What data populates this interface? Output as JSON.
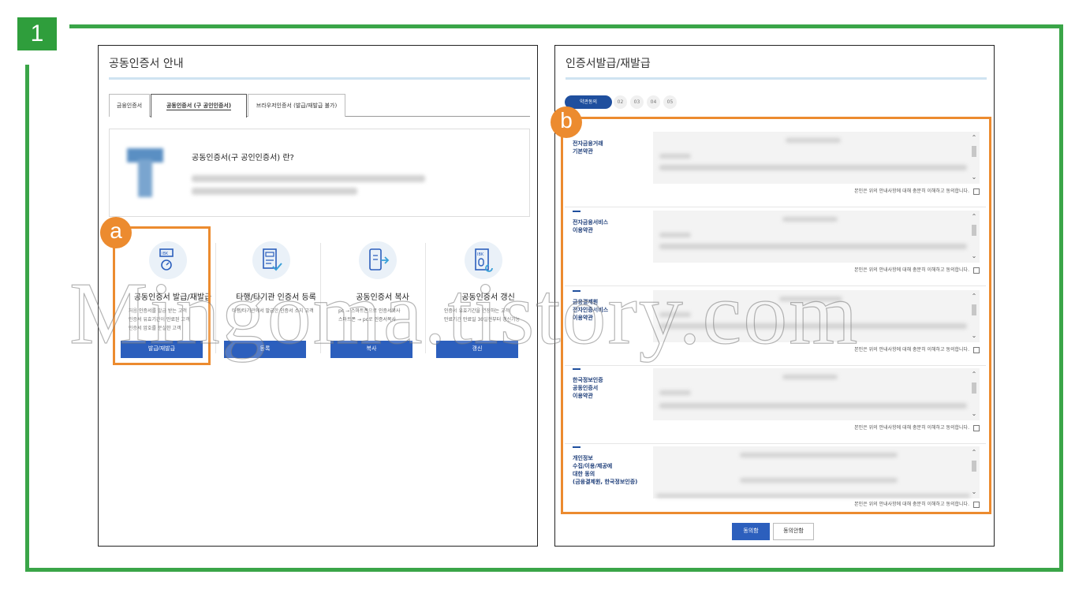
{
  "step_badge": "1",
  "left_panel": {
    "title": "공동인증서 안내",
    "tabs": [
      {
        "label": "금융인증서",
        "active": false
      },
      {
        "label": "공동인증서 (구 공인인증서)",
        "active": true
      },
      {
        "label": "브라우저인증서 (발급/재발급 불가)",
        "active": false
      }
    ],
    "info_heading": "공동인증서(구 공인인증서) 란?",
    "cards": [
      {
        "title": "공동인증서 발급/재발급",
        "icon": "certificate-renew-icon",
        "desc": [
          "처음 인증서를 발급 받는 고객",
          "인증서 유효기간이 만료된 고객",
          "인증서 암호를 분실한 고객"
        ],
        "button": "발급/재발급"
      },
      {
        "title": "타행/타기관 인증서 등록",
        "icon": "document-check-icon",
        "desc": [
          "타행/타기관에서 발급한 인증서 소지 고객"
        ],
        "button": "등록"
      },
      {
        "title": "공동인증서 복사",
        "icon": "phone-copy-icon",
        "desc": [
          "pc → 스마트폰으로 인증서복사",
          "스마트폰 → pc로 인증서복사"
        ],
        "button": "복사"
      },
      {
        "title": "공동인증서 갱신",
        "icon": "certificate-refresh-icon",
        "desc": [
          "인증서 유효기간을 연장하는 고객",
          "만료기간 만료일 30일전부터 갱신가능"
        ],
        "button": "갱신"
      }
    ]
  },
  "right_panel": {
    "title": "인증서발급/재발급",
    "steps": {
      "active": "약관동의",
      "others": [
        "02",
        "03",
        "04",
        "05"
      ]
    },
    "terms": [
      {
        "label": "전자금융거래\n기본약관"
      },
      {
        "label": "전자금융서비스\n이용약관"
      },
      {
        "label": "금융결제원\n전자인증서비스\n이용약관"
      },
      {
        "label": "한국정보인증\n공동인증서\n이용약관"
      },
      {
        "label": "개인정보\n수집/이용/제공에\n대한 동의\n(금융결제원, 한국정보인증)"
      }
    ],
    "agree_text": "본인은 위의 안내사항에 대해 충분히 이해하고 동의합니다.",
    "buttons": {
      "agree": "동의함",
      "disagree": "동의안함"
    }
  },
  "markers": {
    "a": "a",
    "b": "b"
  },
  "watermark": "Mingoma.tistory.com",
  "colors": {
    "frame_green": "#3aa548",
    "highlight_orange": "#ec8b2f",
    "button_blue": "#2c5fbd",
    "step_navy": "#1f4f9e"
  }
}
